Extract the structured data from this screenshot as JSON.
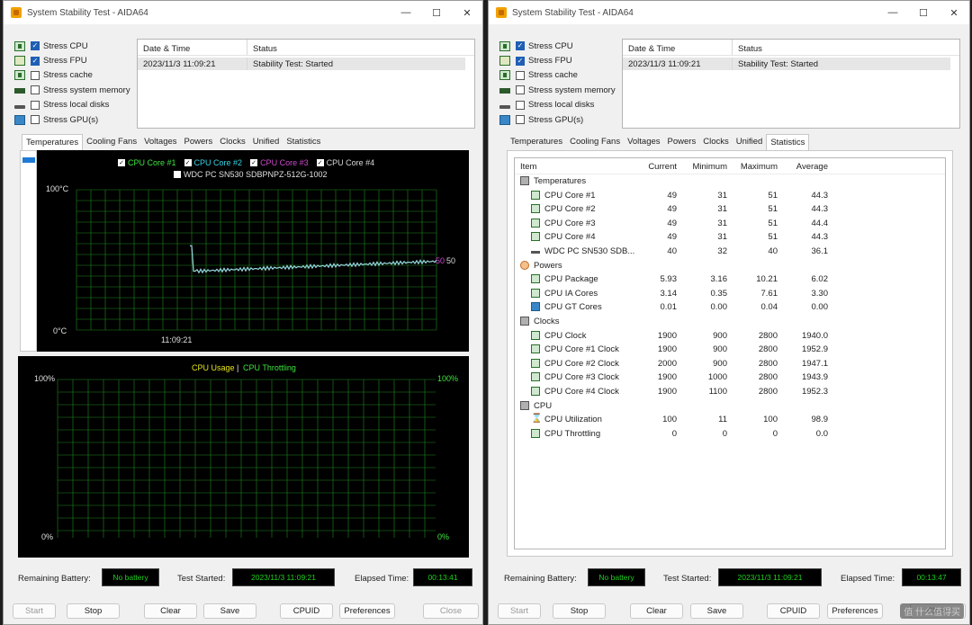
{
  "window_title": "System Stability Test - AIDA64",
  "window_controls": {
    "minimize": "—",
    "maximize": "☐",
    "close": "✕"
  },
  "stress_options": [
    {
      "label": "Stress CPU",
      "checked": true,
      "icon": "cpu-chip-icon"
    },
    {
      "label": "Stress FPU",
      "checked": true,
      "icon": "fpu-icon"
    },
    {
      "label": "Stress cache",
      "checked": false,
      "icon": "cache-icon"
    },
    {
      "label": "Stress system memory",
      "checked": false,
      "icon": "memory-icon"
    },
    {
      "label": "Stress local disks",
      "checked": false,
      "icon": "disk-icon"
    },
    {
      "label": "Stress GPU(s)",
      "checked": false,
      "icon": "gpu-icon"
    }
  ],
  "status_table": {
    "headers": [
      "Date & Time",
      "Status"
    ],
    "row": [
      "2023/11/3 11:09:21",
      "Stability Test: Started"
    ]
  },
  "tabs": [
    "Temperatures",
    "Cooling Fans",
    "Voltages",
    "Powers",
    "Clocks",
    "Unified",
    "Statistics"
  ],
  "left": {
    "selected_tab": "Temperatures",
    "temp_chart": {
      "legend": [
        {
          "label": "CPU Core #1",
          "checked": true,
          "color": "#3ee63e"
        },
        {
          "label": "CPU Core #2",
          "checked": true,
          "color": "#36d6e6"
        },
        {
          "label": "CPU Core #3",
          "checked": true,
          "color": "#d04ad0"
        },
        {
          "label": "CPU Core #4",
          "checked": true,
          "color": "#d8d8d8"
        },
        {
          "label": "WDC PC SN530 SDBPNPZ-512G-1002",
          "checked": false,
          "color": "#d8d8d8"
        }
      ],
      "y_top": "100°C",
      "y_bottom": "0°C",
      "x_label": "11:09:21",
      "end_value_label": "50",
      "end_value_label2": "50"
    },
    "usage_chart": {
      "legend_usage": "CPU Usage",
      "legend_sep": "|",
      "legend_throttle": "CPU Throttling",
      "y_top_left": "100%",
      "y_bottom_left": "0%",
      "y_top_right": "100%",
      "y_bottom_right": "0%"
    },
    "bottom": {
      "battery_label": "Remaining Battery:",
      "battery_value": "No battery",
      "started_label": "Test Started:",
      "started_value": "2023/11/3 11:09:21",
      "elapsed_label": "Elapsed Time:",
      "elapsed_value": "00:13:41"
    }
  },
  "right": {
    "selected_tab": "Statistics",
    "stats_headers": [
      "Item",
      "Current",
      "Minimum",
      "Maximum",
      "Average"
    ],
    "stats_rows": [
      {
        "type": "cat",
        "item": "Temperatures",
        "icon": "thermometer-icon"
      },
      {
        "type": "row",
        "item": "CPU Core #1",
        "cur": "49",
        "min": "31",
        "max": "51",
        "avg": "44.3",
        "icon": "cpu-chip-icon"
      },
      {
        "type": "row",
        "item": "CPU Core #2",
        "cur": "49",
        "min": "31",
        "max": "51",
        "avg": "44.3",
        "icon": "cpu-chip-icon"
      },
      {
        "type": "row",
        "item": "CPU Core #3",
        "cur": "49",
        "min": "31",
        "max": "51",
        "avg": "44.4",
        "icon": "cpu-chip-icon"
      },
      {
        "type": "row",
        "item": "CPU Core #4",
        "cur": "49",
        "min": "31",
        "max": "51",
        "avg": "44.3",
        "icon": "cpu-chip-icon"
      },
      {
        "type": "row",
        "item": "WDC PC SN530 SDB...",
        "cur": "40",
        "min": "32",
        "max": "40",
        "avg": "36.1",
        "icon": "disk-icon"
      },
      {
        "type": "cat",
        "item": "Powers",
        "icon": "power-icon"
      },
      {
        "type": "row",
        "item": "CPU Package",
        "cur": "5.93",
        "min": "3.16",
        "max": "10.21",
        "avg": "6.02",
        "icon": "cpu-chip-icon"
      },
      {
        "type": "row",
        "item": "CPU IA Cores",
        "cur": "3.14",
        "min": "0.35",
        "max": "7.61",
        "avg": "3.30",
        "icon": "cpu-chip-icon"
      },
      {
        "type": "row",
        "item": "CPU GT Cores",
        "cur": "0.01",
        "min": "0.00",
        "max": "0.04",
        "avg": "0.00",
        "icon": "gpu-icon"
      },
      {
        "type": "cat",
        "item": "Clocks",
        "icon": "clock-icon"
      },
      {
        "type": "row",
        "item": "CPU Clock",
        "cur": "1900",
        "min": "900",
        "max": "2800",
        "avg": "1940.0",
        "icon": "cpu-chip-icon"
      },
      {
        "type": "row",
        "item": "CPU Core #1 Clock",
        "cur": "1900",
        "min": "900",
        "max": "2800",
        "avg": "1952.9",
        "icon": "cpu-chip-icon"
      },
      {
        "type": "row",
        "item": "CPU Core #2 Clock",
        "cur": "2000",
        "min": "900",
        "max": "2800",
        "avg": "1947.1",
        "icon": "cpu-chip-icon"
      },
      {
        "type": "row",
        "item": "CPU Core #3 Clock",
        "cur": "1900",
        "min": "1000",
        "max": "2800",
        "avg": "1943.9",
        "icon": "cpu-chip-icon"
      },
      {
        "type": "row",
        "item": "CPU Core #4 Clock",
        "cur": "1900",
        "min": "1100",
        "max": "2800",
        "avg": "1952.3",
        "icon": "cpu-chip-icon"
      },
      {
        "type": "cat",
        "item": "CPU",
        "icon": "cpu-chip-icon"
      },
      {
        "type": "row",
        "item": "CPU Utilization",
        "cur": "100",
        "min": "11",
        "max": "100",
        "avg": "98.9",
        "icon": "hourglass-icon"
      },
      {
        "type": "row",
        "item": "CPU Throttling",
        "cur": "0",
        "min": "0",
        "max": "0",
        "avg": "0.0",
        "icon": "cpu-chip-icon"
      }
    ],
    "bottom": {
      "battery_label": "Remaining Battery:",
      "battery_value": "No battery",
      "started_label": "Test Started:",
      "started_value": "2023/11/3 11:09:21",
      "elapsed_label": "Elapsed Time:",
      "elapsed_value": "00:13:47"
    }
  },
  "buttons": {
    "start": "Start",
    "stop": "Stop",
    "clear": "Clear",
    "save": "Save",
    "cpuid": "CPUID",
    "preferences": "Preferences",
    "close": "Close"
  },
  "watermark": "值 什么值得买"
}
